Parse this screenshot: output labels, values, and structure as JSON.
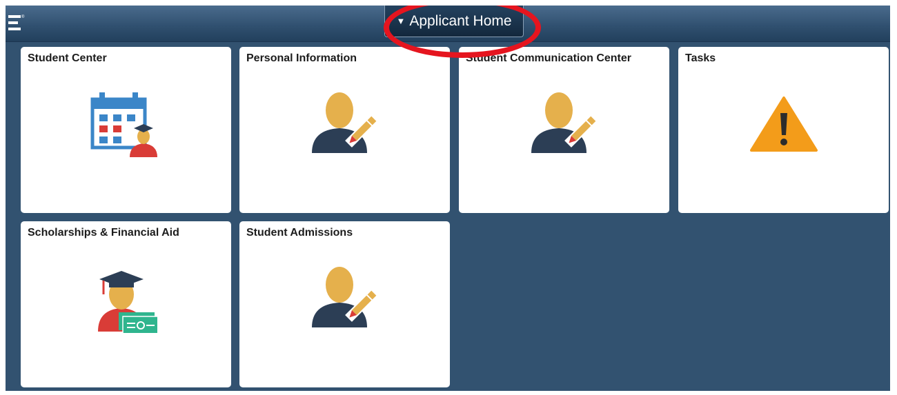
{
  "header": {
    "nav_icon": "navbar-logo-icon",
    "homepage_label": "Applicant Home",
    "caret_glyph": "▼",
    "highlight_color": "#e5151f"
  },
  "tiles": [
    {
      "title": "Student Center",
      "icon": "calendar-student-icon"
    },
    {
      "title": "Personal Information",
      "icon": "person-edit-icon"
    },
    {
      "title": "Student Communication Center",
      "icon": "person-edit-icon"
    },
    {
      "title": "Tasks",
      "icon": "warning-icon"
    },
    {
      "title": "Scholarships & Financial Aid",
      "icon": "graduate-money-icon"
    },
    {
      "title": "Student Admissions",
      "icon": "person-edit-icon"
    }
  ],
  "colors": {
    "background": "#325270",
    "tile": "#ffffff",
    "icon_blue": "#3b86c8",
    "icon_red": "#d93c37",
    "icon_skin": "#e5b04c",
    "icon_dark": "#2c3e55",
    "warning": "#f39c1a",
    "money_green": "#2fb58e"
  }
}
